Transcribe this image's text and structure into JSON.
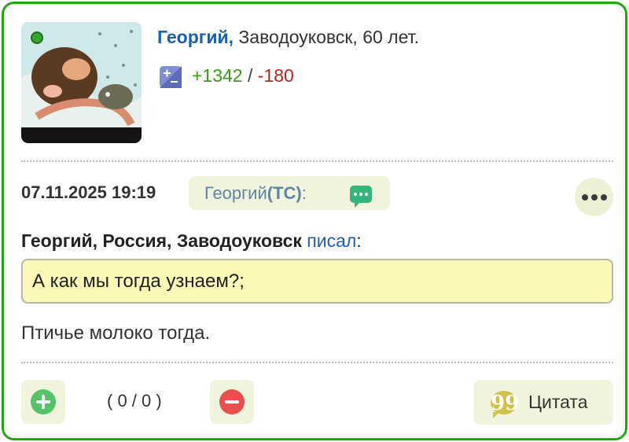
{
  "author": {
    "name": "Георгий",
    "comma": ",",
    "info": "Заводоуковск, 60 лет."
  },
  "rating": {
    "plus": "+1342",
    "separator": " / ",
    "minus": "-180"
  },
  "post": {
    "datetime": "07.11.2025 19:19",
    "topic_starter_name": "Георгий ",
    "topic_starter_tag": "(ТС)",
    "topic_starter_colon": ":",
    "text": "Птичье молоко тогда."
  },
  "quote": {
    "author": "Георгий, Россия, Заводоуковск",
    "wrote": "писал",
    "colon": ":",
    "text": "А как мы тогда узнаем?;"
  },
  "footer": {
    "vote_count": "( 0 / 0 )",
    "quote_label": "Цитата",
    "quote_icon_glyph": "99"
  },
  "colors": {
    "border": "#27a318",
    "author_link": "#1e5fa8",
    "rating_plus": "#3b9a1a",
    "rating_minus": "#b3261e",
    "quote_bg": "#fbf8b8",
    "button_bg": "#f1f4dc",
    "vote_up": "#56c26a",
    "vote_down": "#e8504f"
  },
  "icons": {
    "online": "online-status-dot",
    "rating": "rating-plus-minus-icon",
    "chat": "chat-bubble-icon",
    "more": "more-dots-icon",
    "vote_up": "plus-circle-icon",
    "vote_down": "minus-circle-icon",
    "quote": "quote-bubble-icon"
  }
}
